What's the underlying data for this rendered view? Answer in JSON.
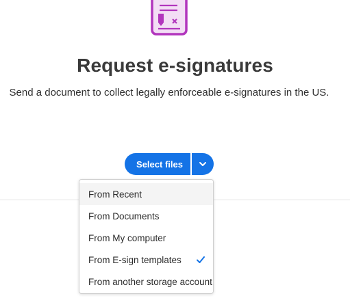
{
  "hero": {
    "icon": "signature-document-icon",
    "accent_color": "#b236bd"
  },
  "title": "Request e-signatures",
  "subtitle": "Send a document to collect legally enforceable e-signatures in the US.",
  "select_button": {
    "label": "Select files",
    "color": "#1473e6",
    "caret_icon": "chevron-down-icon"
  },
  "dropdown": {
    "items": [
      {
        "label": "From Recent",
        "highlighted": true,
        "selected": false
      },
      {
        "label": "From Documents",
        "highlighted": false,
        "selected": false
      },
      {
        "label": "From My computer",
        "highlighted": false,
        "selected": false
      },
      {
        "label": "From E-sign templates",
        "highlighted": false,
        "selected": true
      },
      {
        "label": "From another storage account",
        "highlighted": false,
        "selected": false
      }
    ],
    "check_icon": "checkmark-icon",
    "check_color": "#1473e6"
  }
}
